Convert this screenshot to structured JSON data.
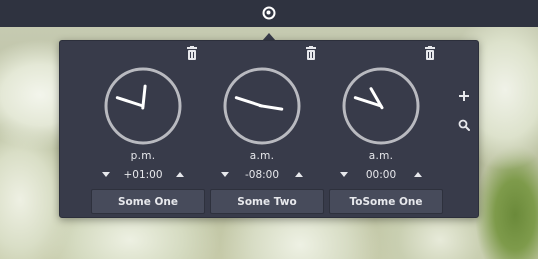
{
  "topbar": {
    "icon": "world-clock-icon"
  },
  "clocks": [
    {
      "name": "Some One",
      "period": "p.m.",
      "offset": "+01:00",
      "hour": 12.2,
      "minute": 48
    },
    {
      "name": "Some Two",
      "period": "a.m.",
      "offset": "-08:00",
      "hour": 3.3,
      "minute": 48
    },
    {
      "name": "ToSome One",
      "period": "a.m.",
      "offset": "00:00",
      "hour": 11.0,
      "minute": 48
    }
  ],
  "actions": {
    "add_icon": "plus-icon",
    "search_icon": "search-icon",
    "delete_icon": "trash-icon"
  },
  "colors": {
    "panel": "#383b4a",
    "topbar": "#2f3340",
    "dial_ring": "#b9bac0",
    "text": "#e7e8ec",
    "button": "#474b5b"
  }
}
